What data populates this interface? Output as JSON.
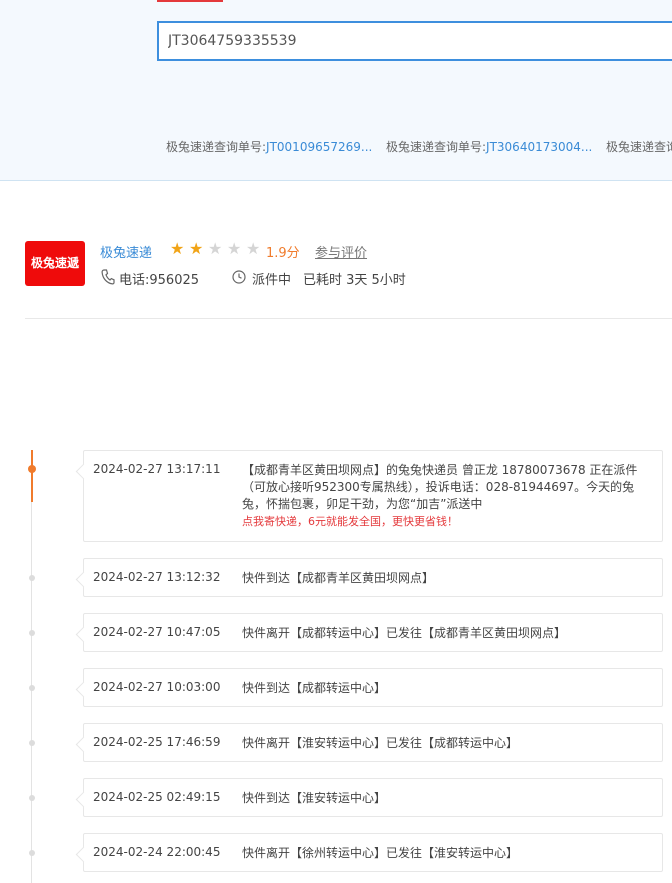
{
  "search": {
    "value": "JT3064759335539"
  },
  "history": [
    {
      "prefix": "极兔速递查询单号:",
      "number": "JT00109657269..."
    },
    {
      "prefix": "极兔速递查询单号:",
      "number": "JT30640173004..."
    },
    {
      "prefix": "极兔速递查询单号:",
      "number": ""
    }
  ],
  "company": {
    "logo_text": "极兔速遞",
    "name": "极兔速递",
    "rating": 2,
    "rating_max": 5,
    "score": "1.9分",
    "rate_link": "参与评价",
    "phone": "电话:956025",
    "status": "派件中",
    "elapsed": "已耗时 3天 5小时",
    "brand_color": "#ef0b0b"
  },
  "timeline": [
    {
      "time": "2024-02-27 13:17:11",
      "desc": "【成都青羊区黄田坝网点】的兔兔快递员 曾正龙 18780073678 正在派件（可放心接听952300专属热线），投诉电话：028-81944697。今天的兔兔，怀揣包裹，卯足干劲，为您“加吉”派送中",
      "promo": "点我寄快递，6元就能发全国，更快更省钱！",
      "active": true
    },
    {
      "time": "2024-02-27 13:12:32",
      "desc": "快件到达【成都青羊区黄田坝网点】"
    },
    {
      "time": "2024-02-27 10:47:05",
      "desc": "快件离开【成都转运中心】已发往【成都青羊区黄田坝网点】"
    },
    {
      "time": "2024-02-27 10:03:00",
      "desc": "快件到达【成都转运中心】"
    },
    {
      "time": "2024-02-25 17:46:59",
      "desc": "快件离开【淮安转运中心】已发往【成都转运中心】"
    },
    {
      "time": "2024-02-25 02:49:15",
      "desc": "快件到达【淮安转运中心】"
    },
    {
      "time": "2024-02-24 22:00:45",
      "desc": "快件离开【徐州转运中心】已发往【淮安转运中心】"
    }
  ],
  "colors": {
    "accent_blue": "#3a8bd6",
    "accent_orange": "#f07b2c",
    "promo_red": "#e4393c"
  }
}
